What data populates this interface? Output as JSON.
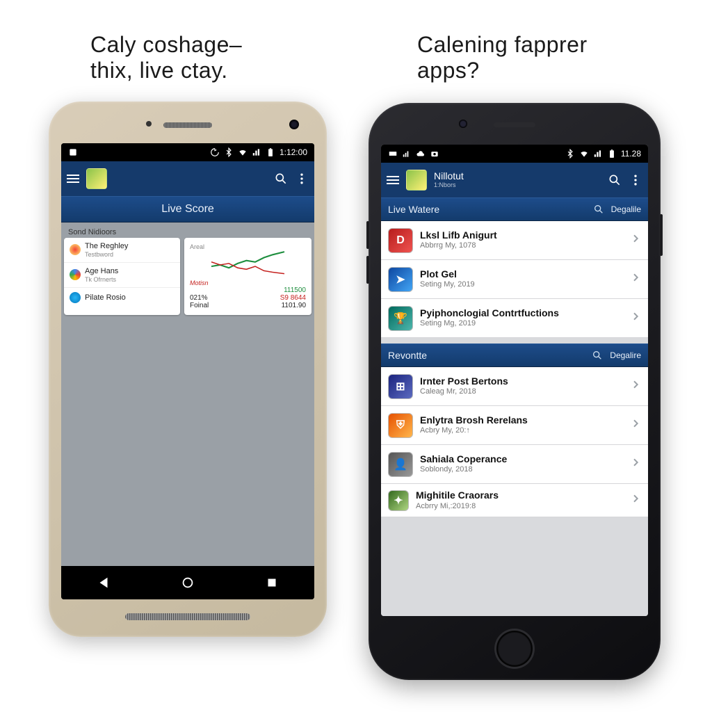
{
  "captions": {
    "left": "Caly coshage–\nthix, live ctay.",
    "right": "Calening fapprer apps?"
  },
  "phone_left": {
    "status_time": "1:12:00",
    "section_title": "Live Score",
    "subheader": "Sond Nidioors",
    "list": [
      {
        "title": "The Reghley",
        "sub": "Testbword"
      },
      {
        "title": "Age Hans",
        "sub": "Tk Ofrnerts"
      },
      {
        "title": "Pilate Rosio",
        "sub": ""
      }
    ],
    "chart": {
      "axis_label": "Areal",
      "mid_label": "Motisn",
      "rows": [
        {
          "l": "",
          "r": "111500"
        },
        {
          "l": "021%",
          "r": "S9 8644"
        },
        {
          "l": "Foinal",
          "r": "1101.90"
        }
      ]
    }
  },
  "phone_right": {
    "status_time": "11.28",
    "app_title": "Nillotut",
    "app_sub": "1:Nbors",
    "sections": [
      {
        "title": "Live Watere",
        "action_label": "Degalile",
        "items": [
          {
            "title": "Lksl Lifb Anigurt",
            "sub": "Abbrrg My, 1078",
            "icon_class": "bg-red",
            "glyph": "D"
          },
          {
            "title": "Plot Gel",
            "sub": "Seting My, 2019",
            "icon_class": "bg-blue",
            "glyph": "➤"
          },
          {
            "title": "Pyiphonclogial Contrtfuctions",
            "sub": "Seting Mg, 2019",
            "icon_class": "bg-teal",
            "glyph": "🏆"
          }
        ]
      },
      {
        "title": "Revontte",
        "action_label": "Degalire",
        "items": [
          {
            "title": "Irnter Post Bertons",
            "sub": "Caleag Mr, 2018",
            "icon_class": "bg-navy",
            "glyph": "⊞"
          },
          {
            "title": "Enlytra Brosh Rerelans",
            "sub": "Acbry My, 20:↑",
            "icon_class": "bg-orange",
            "glyph": "⛨"
          },
          {
            "title": "Sahiala Coperance",
            "sub": "Soblondy, 2018",
            "icon_class": "bg-grey",
            "glyph": "👤"
          },
          {
            "title": "Mighitile Craorars",
            "sub": "Acbrry Mi,:2019:8",
            "icon_class": "bg-lime",
            "glyph": "✦"
          }
        ]
      }
    ]
  },
  "chart_data": {
    "type": "line",
    "title": "Areal",
    "series": [
      {
        "name": "green",
        "values": [
          40,
          42,
          38,
          45,
          50,
          48,
          62,
          75,
          90
        ]
      },
      {
        "name": "red",
        "values": [
          50,
          45,
          48,
          40,
          38,
          42,
          35,
          30,
          28
        ]
      }
    ],
    "xlabel": "",
    "ylabel": "",
    "annotations": [
      "Motisn",
      "111500",
      "021%",
      "S9 8644",
      "Foinal",
      "1101.90"
    ]
  }
}
